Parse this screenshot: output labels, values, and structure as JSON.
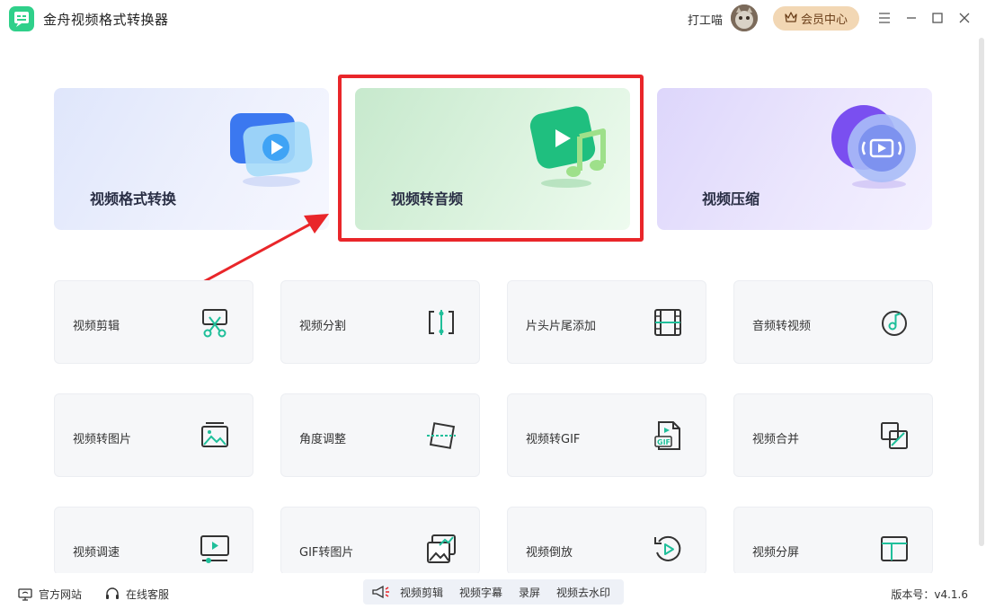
{
  "app": {
    "title": "金舟视频格式转换器"
  },
  "header": {
    "username": "打工喵",
    "vip_label": "会员中心"
  },
  "features": [
    {
      "label": "视频格式转换"
    },
    {
      "label": "视频转音频"
    },
    {
      "label": "视频压缩"
    }
  ],
  "tools": [
    {
      "label": "视频剪辑",
      "icon": "scissors-icon"
    },
    {
      "label": "视频分割",
      "icon": "split-icon"
    },
    {
      "label": "片头片尾添加",
      "icon": "film-strip-icon"
    },
    {
      "label": "音频转视频",
      "icon": "music-note-icon"
    },
    {
      "label": "视频转图片",
      "icon": "image-icon"
    },
    {
      "label": "角度调整",
      "icon": "rotate-frame-icon"
    },
    {
      "label": "视频转GIF",
      "icon": "gif-file-icon"
    },
    {
      "label": "视频合并",
      "icon": "merge-icon"
    },
    {
      "label": "视频调速",
      "icon": "speed-screen-icon"
    },
    {
      "label": "GIF转图片",
      "icon": "gif-image-icon"
    },
    {
      "label": "视频倒放",
      "icon": "reverse-play-icon"
    },
    {
      "label": "视频分屏",
      "icon": "split-screen-icon"
    }
  ],
  "footer": {
    "website_label": "官方网站",
    "service_label": "在线客服",
    "shortcuts": [
      "视频剪辑",
      "视频字幕",
      "录屏",
      "视频去水印"
    ],
    "version": "版本号：v4.1.6"
  },
  "colors": {
    "accent": "#1fbf9a",
    "highlight": "#e9262a",
    "vip_bg": "#f2d7b4"
  }
}
